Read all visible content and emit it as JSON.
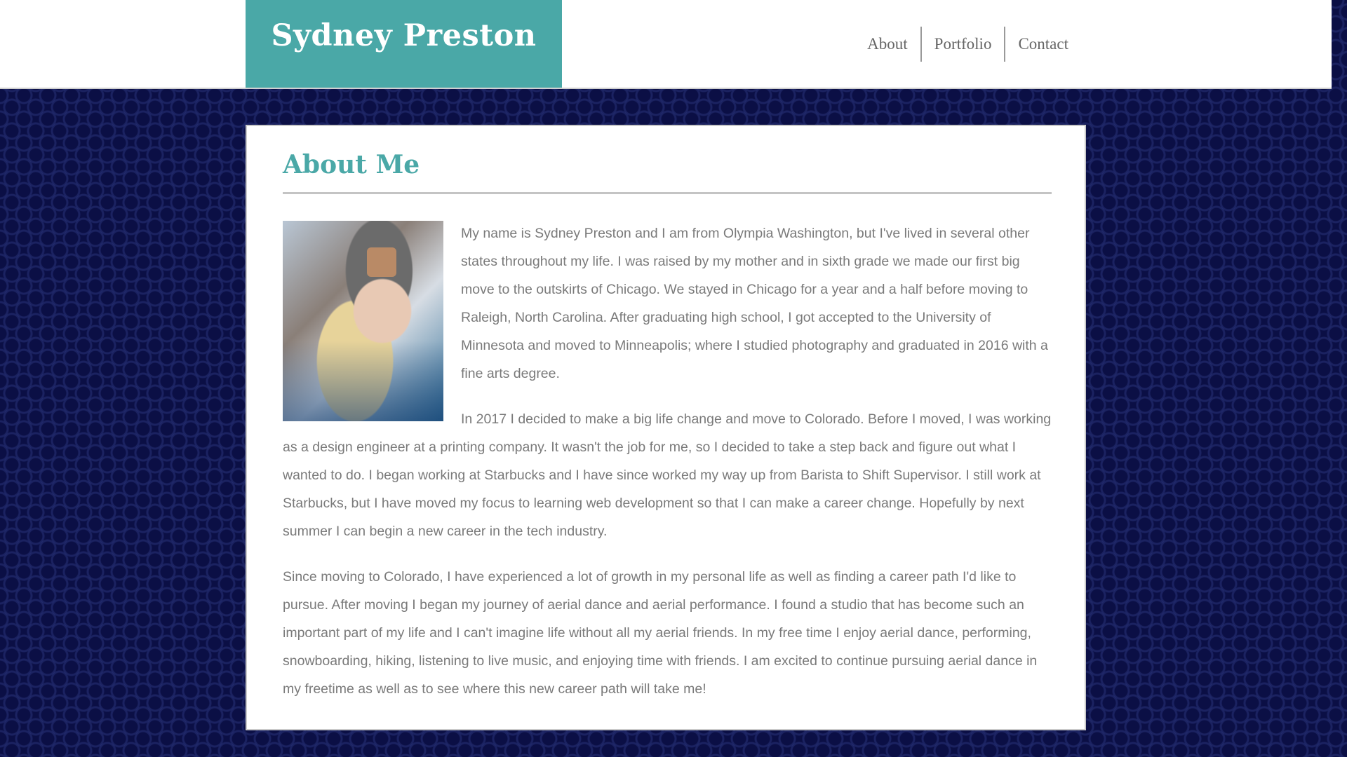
{
  "header": {
    "brand": "Sydney Preston",
    "nav": [
      "About",
      "Portfolio",
      "Contact"
    ]
  },
  "main": {
    "title": "About Me",
    "photo_alt": "portrait photo",
    "paragraphs": [
      "My name is Sydney Preston and I am from Olympia Washington, but I've lived in several other states throughout my life. I was raised by my mother and in sixth grade we made our first big move to the outskirts of Chicago. We stayed in Chicago for a year and a half before moving to Raleigh, North Carolina. After graduating high school, I got accepted to the University of Minnesota and moved to Minneapolis; where I studied photography and graduated in 2016 with a fine arts degree.",
      "In 2017 I decided to make a big life change and move to Colorado. Before I moved, I was working as a design engineer at a printing company. It wasn't the job for me, so I decided to take a step back and figure out what I wanted to do. I began working at Starbucks and I have since worked my way up from Barista to Shift Supervisor. I still work at Starbucks, but I have moved my focus to learning web development so that I can make a career change. Hopefully by next summer I can begin a new career in the tech industry.",
      "Since moving to Colorado, I have experienced a lot of growth in my personal life as well as finding a career path I'd like to pursue. After moving I began my journey of aerial dance and aerial performance. I found a studio that has become such an important part of my life and I can't imagine life without all my aerial friends. In my free time I enjoy aerial dance, performing, snowboarding, hiking, listening to live music, and enjoying time with friends. I am excited to continue pursuing aerial dance in my freetime as well as to see where this new career path will take me!"
    ]
  },
  "colors": {
    "accent": "#4aa8a7",
    "background": "#0b0f45",
    "body_text": "#7a7a7a"
  }
}
